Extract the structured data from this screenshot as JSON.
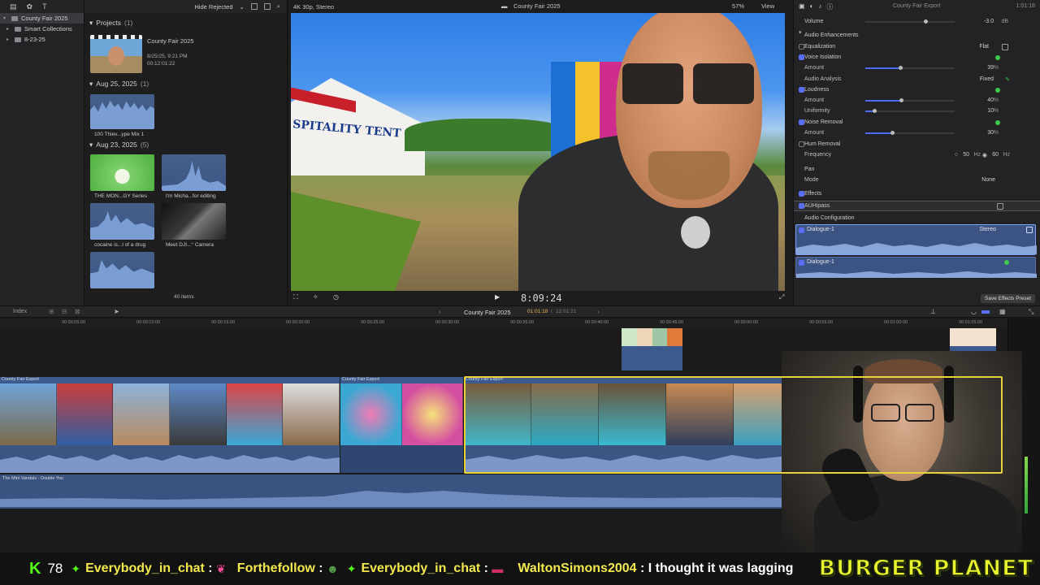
{
  "sidebar": {
    "items": [
      {
        "label": "County Fair 2025",
        "selected": true
      },
      {
        "label": "Smart Collections",
        "selected": false
      },
      {
        "label": "8-23-25",
        "selected": false
      }
    ]
  },
  "browser": {
    "filter_label": "Hide Rejected",
    "projects_title": "Projects",
    "projects_count": "(1)",
    "project": {
      "name": "County Fair 2025",
      "date": "8/25/25, 9:21 PM",
      "duration": "00:12:01:22"
    },
    "groups": [
      {
        "title": "Aug 25, 2025",
        "count": "(1)",
        "clips": [
          "100 Thiev...ype Mix 1"
        ]
      },
      {
        "title": "Aug 23, 2025",
        "count": "(5)",
        "clips": [
          "THE MON...GY Series",
          "I'm Micha...for editing",
          "cocaine is...l of a drug",
          "Meet DJI...° Camera",
          ""
        ]
      }
    ],
    "item_count": "40 items"
  },
  "viewer": {
    "format": "4K 30p, Stereo",
    "title": "County Fair 2025",
    "zoom": "57%",
    "view_label": "View",
    "timecode": "8:09:24",
    "video_sign_text": "SPITALITY TENT"
  },
  "inspector": {
    "clip_name": "County Fair Export",
    "duration": "1:01:18",
    "volume_label": "Volume",
    "volume_value": "-3.0",
    "volume_unit": "dB",
    "audio_enhancements_label": "Audio Enhancements",
    "equalization_label": "Equalization",
    "equalization_value": "Flat",
    "voice_isolation_label": "Voice Isolation",
    "vi_amount_label": "Amount",
    "vi_amount_value": "39",
    "vi_amount_level": 0.39,
    "audio_analysis_label": "Audio Analysis",
    "audio_analysis_value": "Fixed",
    "loudness_label": "Loudness",
    "loud_amount_label": "Amount",
    "loud_amount_value": "40",
    "loud_amount_level": 0.4,
    "uniformity_label": "Uniformity",
    "uniformity_value": "10",
    "uniformity_level": 0.1,
    "noise_removal_label": "Noise Removal",
    "nr_amount_label": "Amount",
    "nr_amount_value": "30",
    "nr_amount_level": 0.3,
    "hum_removal_label": "Hum Removal",
    "frequency_label": "Frequency",
    "freq_50": "50",
    "freq_60": "60",
    "hz_unit": "Hz",
    "pct_unit": "%",
    "pan_label": "Pan",
    "mode_label": "Mode",
    "mode_value": "None",
    "effects_label": "Effects",
    "effect_name": "AUHipass",
    "audio_configuration_label": "Audio Configuration",
    "dialogue_1": "Dialogue-1",
    "dialogue_1_value": "Stereo",
    "dialogue_2": "Dialogue-1",
    "save_preset": "Save Effects Preset"
  },
  "timeline": {
    "index_label": "Index",
    "project_name": "County Fair 2025",
    "position": "01:01:18",
    "total": "12:01:21",
    "ruler": [
      "00:00:05:00",
      "00:00:10:00",
      "00:00:15:00",
      "00:00:20:00",
      "00:00:25:00",
      "00:00:30:00",
      "00:00:35:00",
      "00:00:40:00",
      "00:00:45:00",
      "00:00:50:00",
      "00:00:55:00",
      "00:01:00:00",
      "00:01:05:00"
    ],
    "clip_labels": [
      "County Fair Export",
      "County Fair Export",
      "County Fair Export"
    ],
    "music_label": "The Mini Vandals - Double You"
  },
  "ticker": {
    "kick_count": "78",
    "messages": [
      {
        "user": "Everybody_in_chat",
        "text": ""
      },
      {
        "user": "Forthefollow",
        "text": ""
      },
      {
        "user": "Everybody_in_chat",
        "text": ""
      },
      {
        "user": "WaltonSimons2004",
        "text": "I thought it was lagging"
      }
    ],
    "brand": "BURGER PLANET"
  },
  "colors": {
    "accent": "#5a6cf0",
    "clip_blue": "#3c5684",
    "selection_yellow": "#e8d23c",
    "ticker_yellow": "#f3e94f",
    "kick_green": "#53fc18"
  }
}
